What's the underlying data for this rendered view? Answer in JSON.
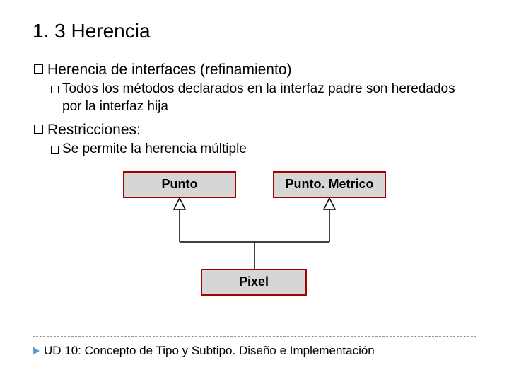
{
  "title": "1. 3 Herencia",
  "bullets": {
    "b1": "Herencia de interfaces (refinamiento)",
    "b1_1": "Todos los métodos declarados en la interfaz padre son heredados por la interfaz hija",
    "b2": "Restricciones:",
    "b2_1": "Se permite la herencia múltiple"
  },
  "uml": {
    "punto": "Punto",
    "punto_metrico": "Punto. Metrico",
    "pixel": "Pixel"
  },
  "footer": "UD 10: Concepto de Tipo y Subtipo. Diseño e Implementación"
}
